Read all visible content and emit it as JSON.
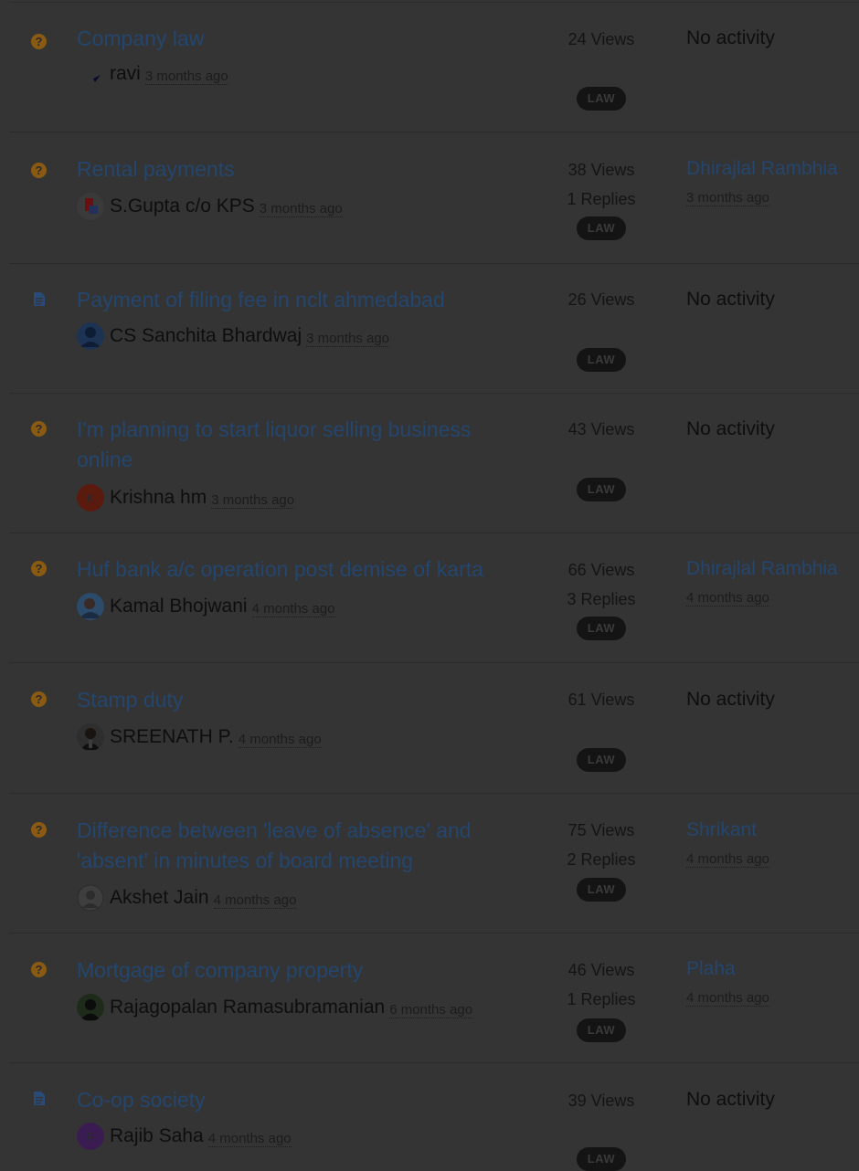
{
  "topics": [
    {
      "type": "question",
      "title": "Company law",
      "author": "ravi",
      "author_ago": "3 months ago",
      "views": "24 Views",
      "replies": "",
      "tag": "LAW",
      "last_activity": "No activity",
      "last_ago": ""
    },
    {
      "type": "question",
      "title": "Rental payments",
      "author": "S.Gupta c/o KPS",
      "author_ago": "3 months ago",
      "views": "38 Views",
      "replies": "1 Replies",
      "tag": "LAW",
      "last_activity": "Dhirajlal Rambhia",
      "last_ago": "3 months ago"
    },
    {
      "type": "document",
      "title": "Payment of filing fee in nclt ahmedabad",
      "author": "CS Sanchita Bhardwaj",
      "author_ago": "3 months ago",
      "views": "26 Views",
      "replies": "",
      "tag": "LAW",
      "last_activity": "No activity",
      "last_ago": ""
    },
    {
      "type": "question",
      "title": "I'm planning to start liquor selling business online",
      "author": "Krishna hm",
      "author_ago": "3 months ago",
      "views": "43 Views",
      "replies": "",
      "tag": "LAW",
      "last_activity": "No activity",
      "last_ago": "",
      "avatar_letter": "K"
    },
    {
      "type": "question",
      "title": "Huf bank a/c operation post demise of karta",
      "author": "Kamal Bhojwani",
      "author_ago": "4 months ago",
      "views": "66 Views",
      "replies": "3 Replies",
      "tag": "LAW",
      "last_activity": "Dhirajlal Rambhia",
      "last_ago": "4 months ago"
    },
    {
      "type": "question",
      "title": "Stamp duty",
      "author": "SREENATH P.",
      "author_ago": "4 months ago",
      "views": "61 Views",
      "replies": "",
      "tag": "LAW",
      "last_activity": "No activity",
      "last_ago": ""
    },
    {
      "type": "question",
      "title": "Difference between 'leave of absence' and 'absent' in minutes of board meeting",
      "author": "Akshet Jain",
      "author_ago": "4 months ago",
      "views": "75 Views",
      "replies": "2 Replies",
      "tag": "LAW",
      "last_activity": "Shrikant",
      "last_ago": "4 months ago"
    },
    {
      "type": "question",
      "title": "Mortgage of company property",
      "author": "Rajagopalan Ramasubramanian",
      "author_ago": "6 months ago",
      "views": "46 Views",
      "replies": "1 Replies",
      "tag": "LAW",
      "last_activity": "Plaha",
      "last_ago": "4 months ago"
    },
    {
      "type": "document",
      "title": "Co-op society",
      "author": "Rajib Saha",
      "author_ago": "4 months ago",
      "views": "39 Views",
      "replies": "",
      "tag": "LAW",
      "last_activity": "No activity",
      "last_ago": "",
      "avatar_letter": "R"
    }
  ],
  "colors": {
    "overlay_bg": "#343434",
    "link": "#24466e",
    "question_icon": "#8a5a12",
    "doc_icon": "#2a4a78"
  }
}
